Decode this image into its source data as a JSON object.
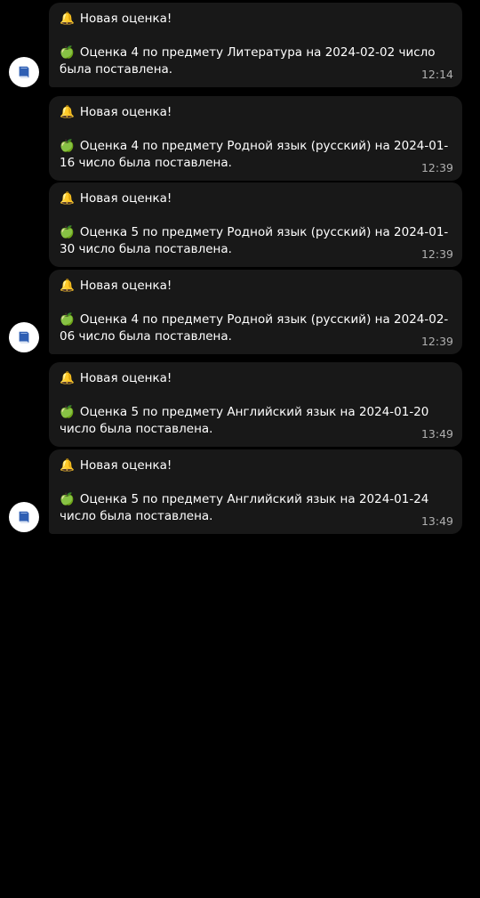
{
  "messages": [
    {
      "title_icon": "bell-icon",
      "title": "Новая оценка!",
      "body_icon": "green-apple-icon",
      "body": "Оценка 4 по предмету Литература на 2024-02-02 число была поставлена.",
      "time": "12:14"
    },
    {
      "title_icon": "bell-icon",
      "title": "Новая оценка!",
      "body_icon": "green-apple-icon",
      "body": "Оценка 4 по предмету Родной язык (русский) на 2024-01-16 число была поставлена.",
      "time": "12:39"
    },
    {
      "title_icon": "bell-icon",
      "title": "Новая оценка!",
      "body_icon": "green-apple-icon",
      "body": "Оценка 5 по предмету Родной язык (русский) на 2024-01-30 число была поставлена.",
      "time": "12:39"
    },
    {
      "title_icon": "bell-icon",
      "title": "Новая оценка!",
      "body_icon": "green-apple-icon",
      "body": "Оценка 4 по предмету Родной язык (русский) на 2024-02-06 число была поставлена.",
      "time": "12:39"
    },
    {
      "title_icon": "bell-icon",
      "title": "Новая оценка!",
      "body_icon": "green-apple-icon",
      "body": "Оценка 5 по предмету Английский язык на 2024-01-20 число была поставлена.",
      "time": "13:49"
    },
    {
      "title_icon": "bell-icon",
      "title": "Новая оценка!",
      "body_icon": "green-apple-icon",
      "body": "Оценка 5 по предмету Английский язык на 2024-01-24 число была поставлена.",
      "time": "13:49"
    }
  ],
  "avatar_icon": "blue-book-icon",
  "colors": {
    "background": "#000000",
    "bubble": "#181818",
    "text": "#ffffff",
    "time": "#b0b0b0",
    "avatar_bg": "#ffffff",
    "book": "#2f5fb3"
  }
}
